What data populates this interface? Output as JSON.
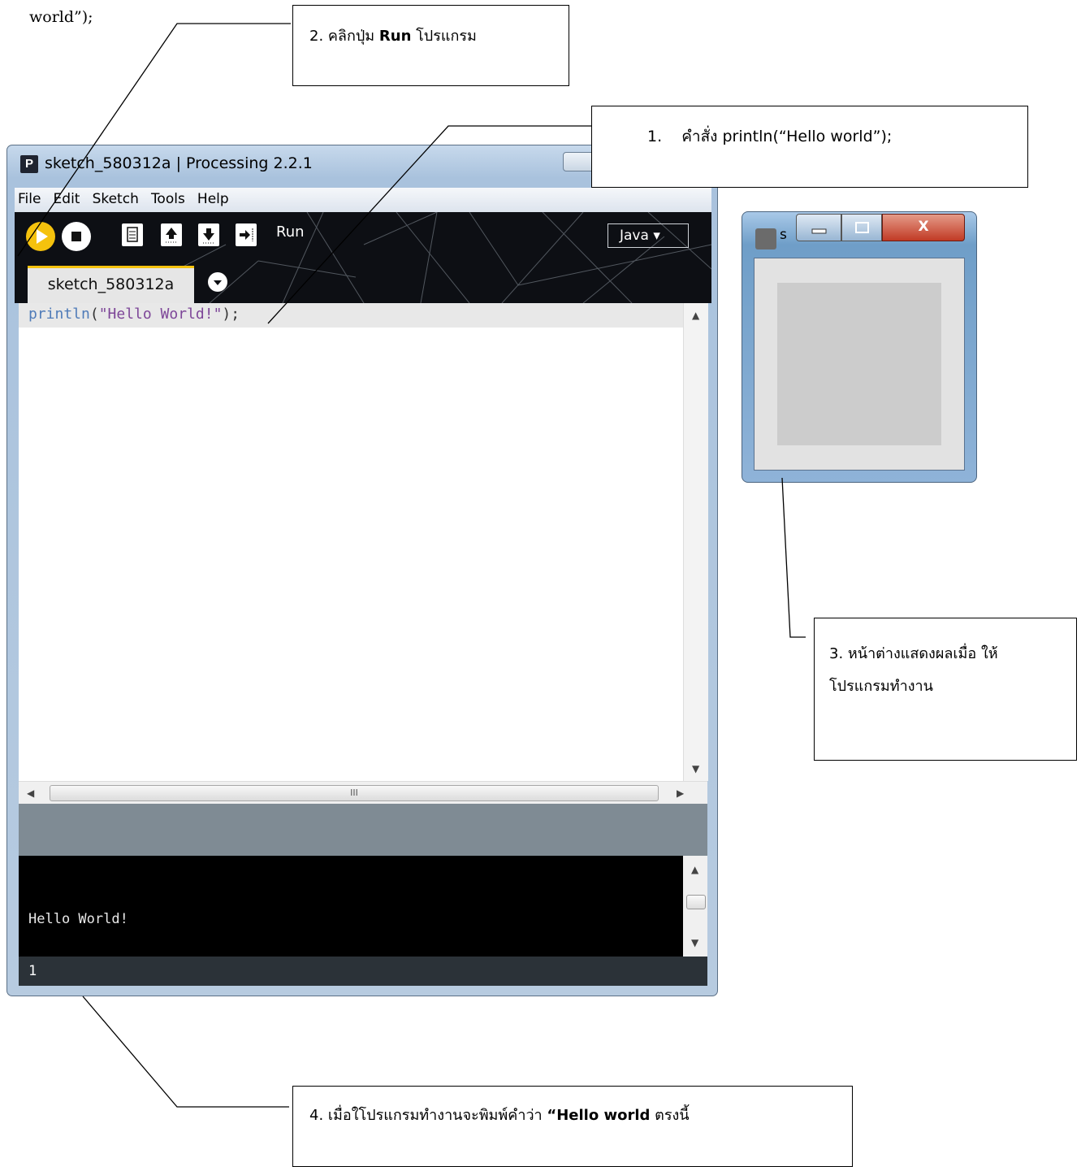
{
  "top_fragment": "world”);",
  "callouts": {
    "step1": {
      "number": "1.",
      "text": "คำสั่ง  println(“Hello world”);"
    },
    "step2": {
      "prefix": "2. คลิกปุ่ม ",
      "bold": "Run",
      "suffix": " โปรแกรม"
    },
    "step3": {
      "line1": "3. หน้าต่างแสดงผลเมื่อ ให้",
      "line2": "โปรแกรมทำงาน"
    },
    "step4": {
      "prefix": "4. เมื่อใโปรแกรมทำงานจะพิมพ์คำว่า ",
      "bold": "“Hello world",
      "suffix": " ตรงนี้"
    }
  },
  "processing_window": {
    "title": "sketch_580312a | Processing 2.2.1",
    "app_icon": "P",
    "menu": [
      "File",
      "Edit",
      "Sketch",
      "Tools",
      "Help"
    ],
    "toolbar": {
      "buttons": [
        "run-icon",
        "stop-icon",
        "new-file-icon",
        "open-icon",
        "save-icon",
        "export-icon"
      ],
      "hover_label": "Run",
      "mode": "Java ▾"
    },
    "tab": {
      "label": "sketch_580312a",
      "menu_icon": "chevron-down-icon"
    },
    "editor": {
      "code_fn": "println",
      "code_paren": "(",
      "code_string": "\"Hello World!\"",
      "code_end": ");"
    },
    "hscroll_grip": "III",
    "console": {
      "output": "Hello World!"
    },
    "status": {
      "line_number": "1"
    }
  },
  "sketch_window": {
    "title_letter": "s",
    "close_label": "X"
  },
  "colors": {
    "run_accent": "#f5c20d",
    "toolbar_bg": "#0d0f14",
    "console_bg": "#000000",
    "code_fn": "#4f7bb8",
    "code_string": "#7d4698"
  }
}
